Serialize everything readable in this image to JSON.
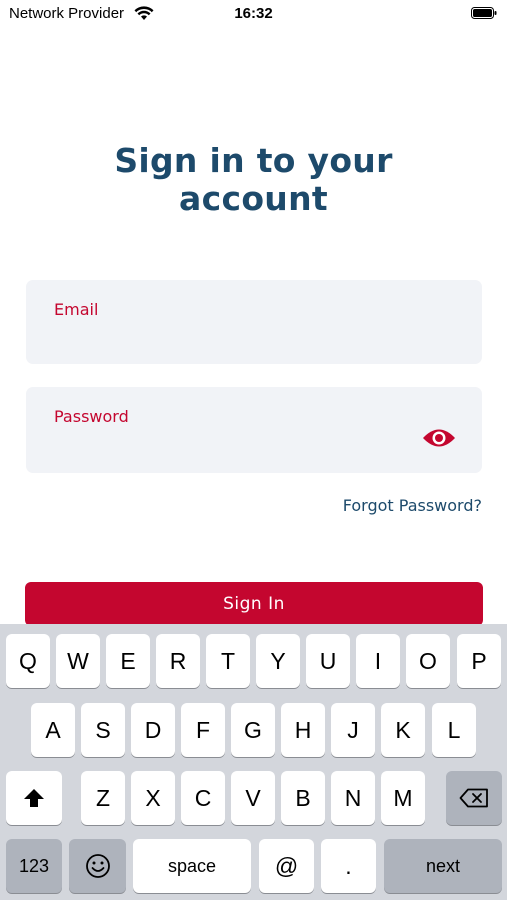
{
  "status_bar": {
    "carrier": "Network Provider",
    "time": "16:32",
    "wifi_icon": "wifi-icon",
    "battery_icon": "battery-icon"
  },
  "login": {
    "title_line1": "Sign in to your",
    "title_line2": "account",
    "email_label": "Email",
    "email_value": "",
    "password_label": "Password",
    "password_value": "",
    "password_toggle_icon": "eye-icon",
    "forgot_password": "Forgot Password?",
    "sign_in": "Sign In"
  },
  "colors": {
    "primary": "#c4062f",
    "title": "#1d4a6b",
    "field_bg": "#f1f3f7",
    "keyboard_bg": "#d3d6dc"
  },
  "keyboard": {
    "row1": [
      "Q",
      "W",
      "E",
      "R",
      "T",
      "Y",
      "U",
      "I",
      "O",
      "P"
    ],
    "row2": [
      "A",
      "S",
      "D",
      "F",
      "G",
      "H",
      "J",
      "K",
      "L"
    ],
    "row3": [
      "Z",
      "X",
      "C",
      "V",
      "B",
      "N",
      "M"
    ],
    "shift_icon": "shift-icon",
    "delete_icon": "backspace-icon",
    "emoji_icon": "emoji-icon",
    "numbers": "123",
    "space": "space",
    "at": "@",
    "dot": ".",
    "next": "next"
  }
}
